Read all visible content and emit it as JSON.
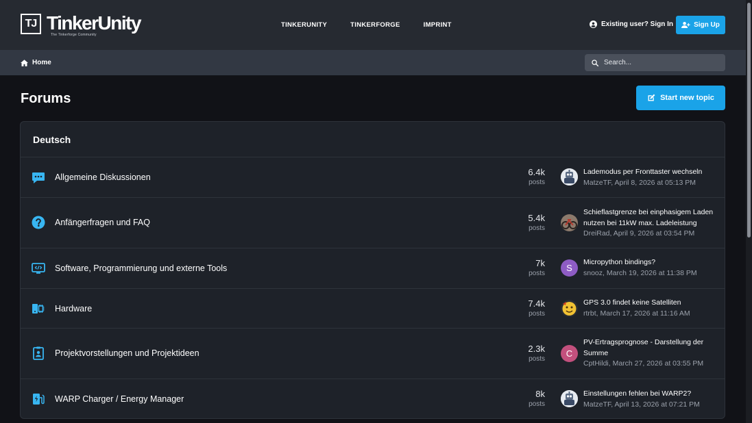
{
  "brand": {
    "logo_mark": "TJ",
    "name": "TinkerUnity",
    "tagline": "The Tinkerforge Community"
  },
  "nav": {
    "items": [
      "TINKERUNITY",
      "TINKERFORGE",
      "IMPRINT"
    ]
  },
  "auth": {
    "signin_label": "Existing user? Sign In",
    "signup_label": "Sign Up"
  },
  "breadcrumb": {
    "home_label": "Home"
  },
  "search": {
    "placeholder": "Search..."
  },
  "page": {
    "title": "Forums",
    "new_topic_label": "Start new topic"
  },
  "category": {
    "name": "Deutsch",
    "forums": [
      {
        "name": "Allgemeine Diskussionen",
        "icon": "chat-bubble-icon",
        "posts": "6.4k",
        "posts_label": "posts",
        "last_title": "Lademodus per Fronttaster wechseln",
        "last_meta": "MatzeTF, April 8, 2026 at 05:13 PM",
        "avatar": "robot-avatar"
      },
      {
        "name": "Anfängerfragen und FAQ",
        "icon": "question-circle-icon",
        "posts": "5.4k",
        "posts_label": "posts",
        "last_title": "Schieflastgrenze bei einphasigem Laden nutzen bei 11kW max. Ladeleistung",
        "last_meta": "DreiRad, April 9, 2026 at 03:54 PM",
        "avatar": "photo-avatar"
      },
      {
        "name": "Software, Programmierung und externe Tools",
        "icon": "monitor-code-icon",
        "posts": "7k",
        "posts_label": "posts",
        "last_title": "Micropython bindings?",
        "last_meta": "snooz, March 19, 2026 at 11:38 PM",
        "avatar": "letter-avatar",
        "avatar_letter": "S",
        "avatar_color": "#8e5cc4"
      },
      {
        "name": "Hardware",
        "icon": "hardware-chip-icon",
        "posts": "7.4k",
        "posts_label": "posts",
        "last_title": "GPS 3.0 findet keine Satelliten",
        "last_meta": "rtrbt, March 17, 2026 at 11:16 AM",
        "avatar": "emoji-avatar"
      },
      {
        "name": "Projektvorstellungen und Projektideen",
        "icon": "clipboard-project-icon",
        "posts": "2.3k",
        "posts_label": "posts",
        "last_title": "PV-Ertragsprognose - Darstellung der Summe",
        "last_meta": "CptHildi, March 27, 2026 at 03:55 PM",
        "avatar": "letter-avatar",
        "avatar_letter": "C",
        "avatar_color": "#c2507d"
      },
      {
        "name": "WARP Charger / Energy Manager",
        "icon": "ev-charger-icon",
        "posts": "8k",
        "posts_label": "posts",
        "last_title": "Einstellungen fehlen bei WARP2?",
        "last_meta": "MatzeTF, April 13, 2026 at 07:21 PM",
        "avatar": "robot-avatar"
      }
    ]
  },
  "colors": {
    "accent": "#1aa3e8",
    "header_bg": "#262a31",
    "crumb_bg": "#323843",
    "page_bg": "#111217",
    "card_bg": "#1e2229",
    "icon_blue": "#38b6f2"
  }
}
